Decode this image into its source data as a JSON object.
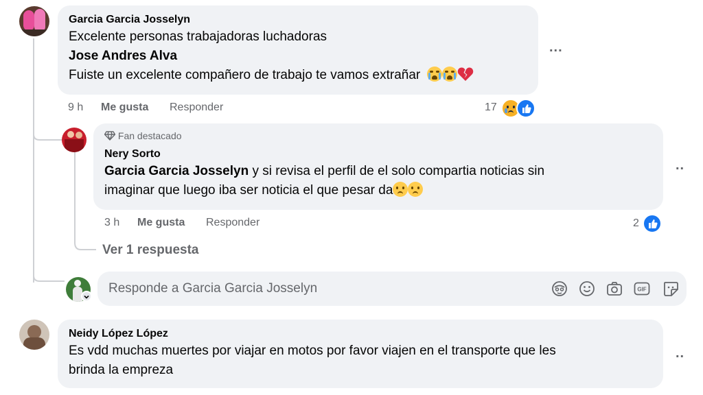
{
  "comment1": {
    "author": "Garcia Garcia Josselyn",
    "line1": "Excelente personas trabajadoras luchadoras",
    "line2_mention": "Jose Andres Alva",
    "line3": "Fuiste un excelente compañero de trabajo te vamos extrañar",
    "time": "9 h",
    "like": "Me gusta",
    "reply": "Responder",
    "reaction_count": "17",
    "more": "..."
  },
  "reply1": {
    "badge": "Fan destacado",
    "author": "Nery Sorto",
    "mention": "Garcia Garcia Josselyn",
    "text_rest": " y si revisa el perfil de el solo compartia noticias sin",
    "line2": "imaginar que luego iba ser noticia el que pesar da",
    "time": "3 h",
    "like": "Me gusta",
    "reply": "Responder",
    "reaction_count": "2",
    "more": ".."
  },
  "view_replies": "Ver 1 respuesta",
  "reply_box": {
    "placeholder": "Responde a Garcia Garcia Josselyn",
    "icons": [
      "avatar-sticker-icon",
      "emoji-icon",
      "camera-icon",
      "gif-icon",
      "sticker-icon"
    ],
    "gif_label": "GIF"
  },
  "comment2": {
    "author": "Neidy López López",
    "line1": "Es vdd muchas muertes por viajar en motos por favor viajen en el transporte que les",
    "line2": "brinda la empreza",
    "more": ".."
  },
  "colors": {
    "bubble": "#f0f2f5",
    "muted": "#65676b",
    "like_blue": "#1877f2",
    "thread_line": "#ced0d4"
  }
}
